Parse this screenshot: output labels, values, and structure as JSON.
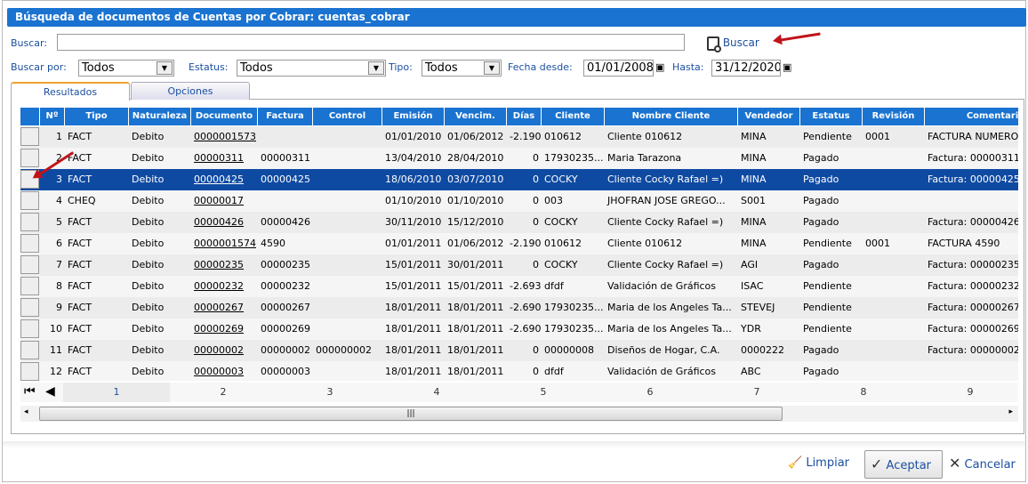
{
  "title": "Búsqueda de documentos de Cuentas por Cobrar: cuentas_cobrar",
  "search": {
    "label": "Buscar:",
    "value": "",
    "button": "Buscar"
  },
  "filters": {
    "buscar_por_label": "Buscar por:",
    "buscar_por": "Todos",
    "estatus_label": "Estatus:",
    "estatus": "Todos",
    "tipo_label": "Tipo:",
    "tipo": "Todos",
    "desde_label": "Fecha desde:",
    "desde": "01/01/2008",
    "hasta_label": "Hasta:",
    "hasta": "31/12/2020"
  },
  "tabs": [
    "Resultados",
    "Opciones"
  ],
  "columns": [
    "",
    "Nº",
    "Tipo",
    "Naturaleza",
    "Documento",
    "Factura",
    "Control",
    "Emisión",
    "Vencim.",
    "Días",
    "Cliente",
    "Nombre Cliente",
    "Vendedor",
    "Estatus",
    "Revisión",
    "Comentario"
  ],
  "rows": [
    [
      "1",
      "FACT",
      "Debito",
      "0000001573",
      "",
      "",
      "01/01/2010",
      "01/06/2012",
      "-2.190",
      "010612",
      "Cliente 010612",
      "MINA",
      "Pendiente",
      "0001",
      "FACTURA NUMERO"
    ],
    [
      "2",
      "FACT",
      "Debito",
      "00000311",
      "00000311",
      "",
      "13/04/2010",
      "28/04/2010",
      "0",
      "17930235...",
      "Maria Tarazona",
      "MINA",
      "Pagado",
      "",
      "Factura: 00000311"
    ],
    [
      "3",
      "FACT",
      "Debito",
      "00000425",
      "00000425",
      "",
      "18/06/2010",
      "03/07/2010",
      "0",
      "COCKY",
      "Cliente Cocky Rafael =)",
      "MINA",
      "Pagado",
      "",
      "Factura: 00000425"
    ],
    [
      "4",
      "CHEQ",
      "Debito",
      "00000017",
      "",
      "",
      "01/10/2010",
      "01/10/2010",
      "0",
      "003",
      "JHOFRAN JOSE GREGO...",
      "S001",
      "Pagado",
      "",
      ""
    ],
    [
      "5",
      "FACT",
      "Debito",
      "00000426",
      "00000426",
      "",
      "30/11/2010",
      "15/12/2010",
      "0",
      "COCKY",
      "Cliente Cocky Rafael =)",
      "MINA",
      "Pagado",
      "",
      "Factura: 00000426"
    ],
    [
      "6",
      "FACT",
      "Debito",
      "0000001574",
      "4590",
      "",
      "01/01/2011",
      "01/06/2012",
      "-2.190",
      "010612",
      "Cliente 010612",
      "MINA",
      "Pendiente",
      "0001",
      "FACTURA 4590"
    ],
    [
      "7",
      "FACT",
      "Debito",
      "00000235",
      "00000235",
      "",
      "15/01/2011",
      "30/01/2011",
      "0",
      "COCKY",
      "Cliente Cocky Rafael =)",
      "AGI",
      "Pagado",
      "",
      "Factura: 00000235"
    ],
    [
      "8",
      "FACT",
      "Debito",
      "00000232",
      "00000232",
      "",
      "15/01/2011",
      "15/01/2011",
      "-2.693",
      "dfdf",
      "Validación de Gráficos",
      "ISAC",
      "Pendiente",
      "",
      "Factura: 00000232"
    ],
    [
      "9",
      "FACT",
      "Debito",
      "00000267",
      "00000267",
      "",
      "18/01/2011",
      "18/01/2011",
      "-2.690",
      "17930235...",
      "Maria de los Angeles Ta...",
      "STEVEJ",
      "Pendiente",
      "",
      "Factura: 00000267"
    ],
    [
      "10",
      "FACT",
      "Debito",
      "00000269",
      "00000269",
      "",
      "18/01/2011",
      "18/01/2011",
      "-2.690",
      "17930235...",
      "Maria de los Angeles Ta...",
      "YDR",
      "Pendiente",
      "",
      "Factura: 00000269"
    ],
    [
      "11",
      "FACT",
      "Debito",
      "00000002",
      "00000002",
      "000000002",
      "18/01/2011",
      "18/01/2011",
      "0",
      "00000008",
      "Diseños de Hogar, C.A.",
      "0000222",
      "Pagado",
      "",
      "Factura: 00000002"
    ],
    [
      "12",
      "FACT",
      "Debito",
      "00000003",
      "00000003",
      "",
      "18/01/2011",
      "18/01/2011",
      "0",
      "dfdf",
      "Validación de Gráficos",
      "ABC",
      "Pagado",
      "",
      ""
    ]
  ],
  "selected_row": 3,
  "pages": [
    "1",
    "2",
    "3",
    "4",
    "5",
    "6",
    "7",
    "8",
    "9"
  ],
  "current_page": "1",
  "footer": {
    "limpiar": "Limpiar",
    "aceptar": "Aceptar",
    "cancelar": "Cancelar"
  },
  "colors": {
    "header": "#1a73d0",
    "selected": "#0f4aa2",
    "annotation_arrow": "#c0141a"
  }
}
